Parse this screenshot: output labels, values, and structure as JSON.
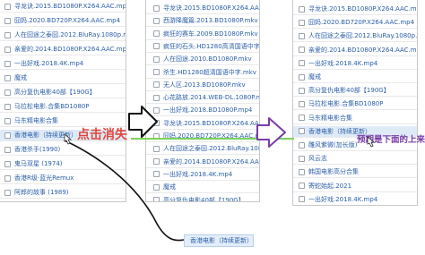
{
  "panel_left": {
    "rows": [
      "寻龙诀.2015.BD1080P.X264.AAC.mp4",
      "囧妈.2020.BD720P.X264.AAC.mp4",
      "人在囧途之泰囧.2012.BluRay.1080p.mkv",
      "亲爱的.2014.BD1080P.X264.AAC.mp4",
      "一出好戏.2018.4K.mp4",
      "魔戒",
      "高分复仇电影40部【190G】",
      "马拉松电影.合集BD1080P",
      "马东精电影合集",
      "香港电影（持续更新）",
      "香港杀手(1990)",
      "鬼马双星 (1974)",
      "香港R级·蓝光Remux",
      "阿郎的故事 (1989)"
    ]
  },
  "panel_middle": {
    "rows": [
      "寻龙诀.2015.BD1080P.X264.AAC.mp4",
      "西游降魔篇.2013.BD1080P.mkv",
      "疯狂的赛车.2009.BD1080P.mkv",
      "疯狂的石头.HD1280高清国语中字.mkv",
      "人在囧途.2010.BD1080P.mkv",
      "杀生.HD1280超清国语中字.mkv",
      "无人区.2013.BD1080P.mkv",
      "心花路放.2014.WEB-DL.1080P.mp4",
      "一出好戏.2018.BD1080P.mp4",
      "寻龙诀.2015.BD1080P.X264.AAC.mp4",
      "囧妈.2020.BD720P.X264.AAC.mp4",
      "人在囧途之泰囧.2012.BluRay.1080p.mkv",
      "亲爱的.2014.BD1080P.X264.AAC.mp4",
      "一出好戏.2018.4K.mp4",
      "魔戒",
      "高分复仇电影40部【190G】"
    ]
  },
  "panel_right": {
    "rows": [
      "寻龙诀.2015.BD1080P.X264.AAC.mp4",
      "囧妈.2020.BD720P.X264.AAC.mp4",
      "人在囧途之泰囧.2012.BluRay.1080p.mkv",
      "亲爱的.2014.BD1080P.X264.AAC.mp4",
      "一出好戏.2018.4K.mp4",
      "魔戒",
      "高分复仇电影40部【190G】",
      "马拉松电影.合集BD1080P",
      "马东精电影合集",
      "香港电影（持续更新）",
      "雕风紫微(加长版)",
      "风云志",
      "韩国电影高分合集",
      "寄蛇始起.2021",
      "一出好戏.2018.4K.mp4"
    ]
  },
  "annotations": {
    "left_label": "点击消失",
    "right_label": "预期是下面的上来"
  },
  "drag_ghost": "香港电影（持续更新）"
}
